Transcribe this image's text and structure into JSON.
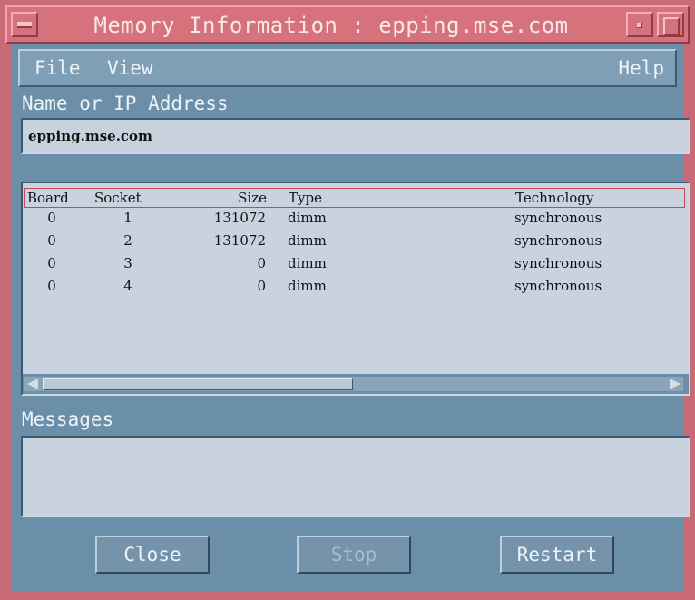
{
  "window": {
    "title": "Memory Information : epping.mse.com"
  },
  "menubar": {
    "file": "File",
    "view": "View",
    "help": "Help"
  },
  "name_field": {
    "label": "Name or IP Address",
    "value": "epping.mse.com"
  },
  "table": {
    "columns": [
      "Board",
      "Socket",
      "Size",
      "Type",
      "Technology"
    ],
    "rows": [
      {
        "board": "0",
        "socket": "1",
        "size": "131072",
        "type": "dimm",
        "technology": "synchronous"
      },
      {
        "board": "0",
        "socket": "2",
        "size": "131072",
        "type": "dimm",
        "technology": "synchronous"
      },
      {
        "board": "0",
        "socket": "3",
        "size": "0",
        "type": "dimm",
        "technology": "synchronous"
      },
      {
        "board": "0",
        "socket": "4",
        "size": "0",
        "type": "dimm",
        "technology": "synchronous"
      }
    ]
  },
  "messages": {
    "label": "Messages"
  },
  "buttons": {
    "close": "Close",
    "stop": "Stop",
    "restart": "Restart"
  },
  "colors": {
    "window_frame": "#c96b74",
    "client_bg": "#6b8fa8",
    "field_bg": "#c9d3df",
    "header_outline": "#c44a57"
  }
}
